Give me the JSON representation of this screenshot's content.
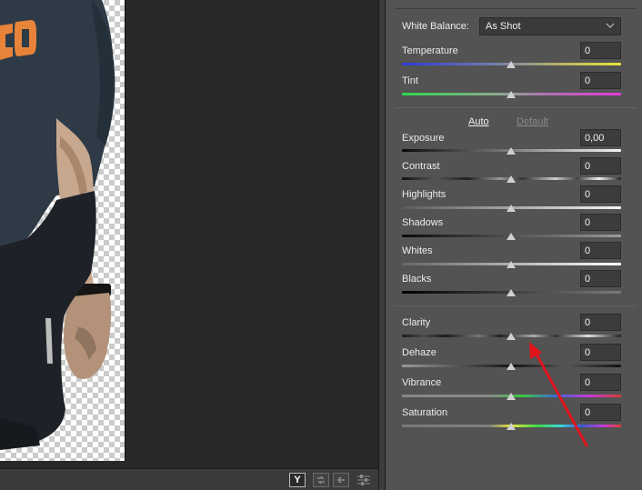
{
  "canvas": {
    "photo_description_icon": "person-photo"
  },
  "status_bar": {
    "compare_label": "Y",
    "swap_icon": "swap-icon",
    "copy_icon": "copy-settings-icon",
    "settings_icon": "sliders-icon"
  },
  "panel": {
    "white_balance": {
      "label": "White Balance:",
      "selected": "As Shot"
    },
    "temperature": {
      "label": "Temperature",
      "value": "0"
    },
    "tint": {
      "label": "Tint",
      "value": "0"
    },
    "auto_label": "Auto",
    "default_label": "Default",
    "exposure": {
      "label": "Exposure",
      "value": "0,00"
    },
    "contrast": {
      "label": "Contrast",
      "value": "0"
    },
    "highlights": {
      "label": "Highlights",
      "value": "0"
    },
    "shadows": {
      "label": "Shadows",
      "value": "0"
    },
    "whites": {
      "label": "Whites",
      "value": "0"
    },
    "blacks": {
      "label": "Blacks",
      "value": "0"
    },
    "clarity": {
      "label": "Clarity",
      "value": "0"
    },
    "dehaze": {
      "label": "Dehaze",
      "value": "0"
    },
    "vibrance": {
      "label": "Vibrance",
      "value": "0"
    },
    "saturation": {
      "label": "Saturation",
      "value": "0"
    }
  },
  "annotation": {
    "color": "#e0141c",
    "icon": "red-arrow-pointing-to-clarity"
  }
}
